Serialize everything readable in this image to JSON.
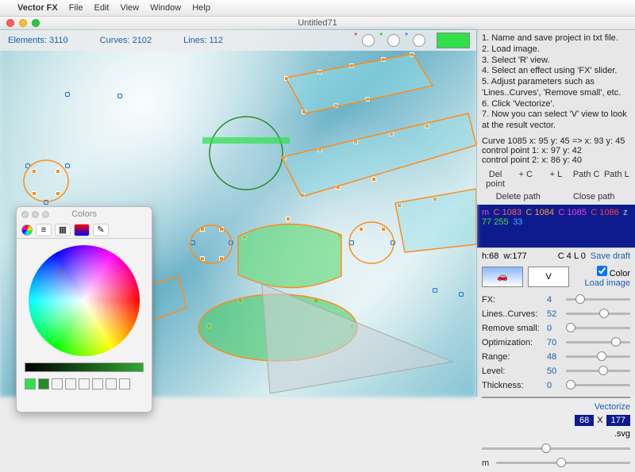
{
  "menubar": {
    "apple": "",
    "app": "Vector FX",
    "items": [
      "File",
      "Edit",
      "View",
      "Window",
      "Help"
    ]
  },
  "window": {
    "title": "Untitled71"
  },
  "stats": {
    "elements_label": "Elements:",
    "elements": "3110",
    "curves_label": "Curves:",
    "curves": "2102",
    "lines_label": "Lines:",
    "lines": "112"
  },
  "colors_panel": {
    "title": "Colors"
  },
  "instructions": [
    "1. Name and save project in txt file.",
    "2. Load image.",
    "3. Select 'R' view.",
    "4. Select an effect using 'FX' slider.",
    "5. Adjust parameters such as 'Lines..Curves', 'Remove small', etc.",
    "6. Click 'Vectorize'.",
    "7. Now you can select 'V' view to look at the result vector."
  ],
  "coords": {
    "l1": "Curve   1085       x: 95 y: 45       =>       x: 93 y: 45",
    "l2": "control point 1:       x: 97 y: 42",
    "l3": "control point 2:       x: 86 y: 40"
  },
  "pathbtns": {
    "a": "Del point",
    "b": "+ C",
    "c": "+ L",
    "d": "Path C",
    "e": "Path L",
    "f": "Delete path",
    "g": "Close path"
  },
  "pathstr": {
    "m": "m",
    "c1": "C 1083",
    "c2": "C 1084",
    "c3": "C 1085",
    "c4": "C 1086",
    "z": "z",
    "g": "77 255",
    "b": "33"
  },
  "infobox": {
    "h": "h:68",
    "w": "w:177",
    "cl": "C 4 L 0",
    "save": "Save draft",
    "color": "Color",
    "v": "V",
    "load": "Load image"
  },
  "sliders": [
    {
      "lbl": "FX:",
      "val": "4",
      "pos": 15
    },
    {
      "lbl": "Lines..Curves:",
      "val": "52",
      "pos": 52
    },
    {
      "lbl": "Remove small:",
      "val": "0",
      "pos": 0
    },
    {
      "lbl": "Optimization:",
      "val": "70",
      "pos": 70
    },
    {
      "lbl": "Range:",
      "val": "48",
      "pos": 48
    },
    {
      "lbl": "Level:",
      "val": "50",
      "pos": 50
    },
    {
      "lbl": "Thickness:",
      "val": "0",
      "pos": 0
    }
  ],
  "vectorize": "Vectorize",
  "dims": {
    "w": "68",
    "x": "X",
    "h": "177",
    "ext": ".svg"
  },
  "m_label": "m"
}
